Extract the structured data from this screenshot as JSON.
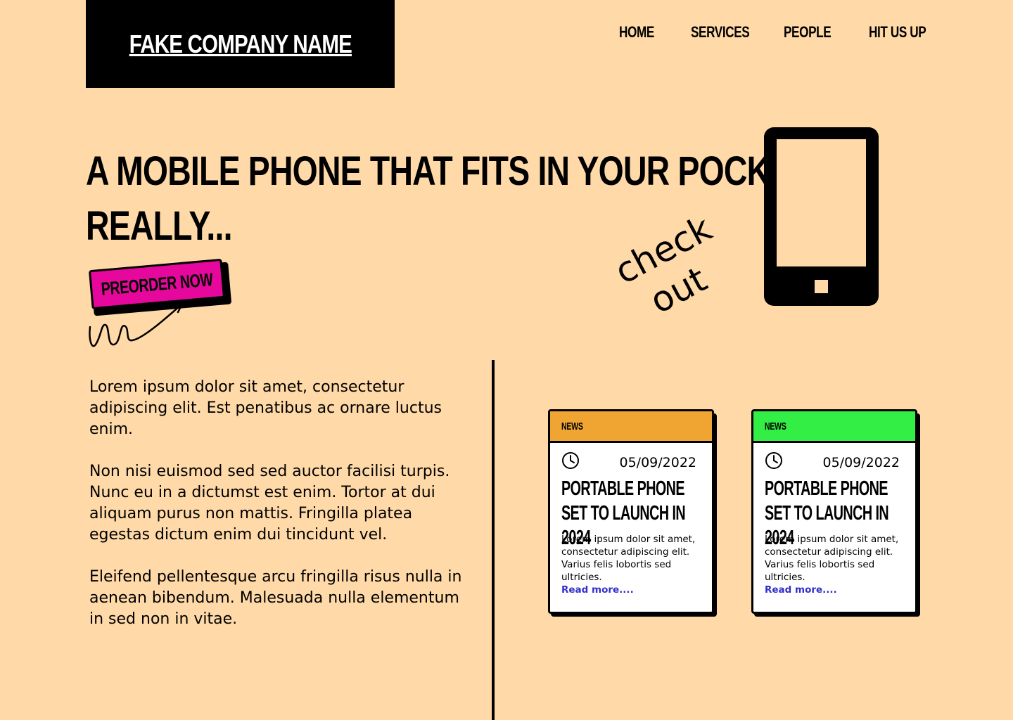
{
  "brand": {
    "name": "FAKE COMPANY NAME"
  },
  "nav": {
    "items": [
      {
        "label": "HOME"
      },
      {
        "label": "SERVICES"
      },
      {
        "label": "PEOPLE"
      },
      {
        "label": "HIT US UP"
      }
    ]
  },
  "hero": {
    "title_line1": "A MOBILE PHONE THAT FITS IN YOUR POCKET.",
    "title_line2": "REALLY...",
    "cta_label": "PREORDER NOW",
    "checkout_line1": "check",
    "checkout_line2": "out",
    "phone_icon": "mobile-phone-icon"
  },
  "body": {
    "paragraphs": [
      "Lorem ipsum dolor sit amet, consectetur adipiscing elit. Est penatibus ac ornare luctus enim.",
      "Non nisi euismod sed sed auctor facilisi turpis. Nunc eu in a dictumst est enim. Tortor at dui aliquam purus non mattis. Fringilla platea egestas dictum enim dui tincidunt vel.",
      "Eleifend pellentesque arcu fringilla risus nulla in aenean bibendum. Malesuada nulla elementum in sed non in vitae."
    ]
  },
  "news": {
    "cards": [
      {
        "tag": "NEWS",
        "date": "05/09/2022",
        "title": "PORTABLE PHONE SET TO LAUNCH IN 2024",
        "excerpt": "Lorem ipsum dolor sit amet, consectetur adipiscing elit. Varius felis lobortis sed ultricies.",
        "link": "Read more....",
        "header_color": "#F0A532"
      },
      {
        "tag": "NEWS",
        "date": "05/09/2022",
        "title": "PORTABLE PHONE SET TO LAUNCH IN 2024",
        "excerpt": "Lorem ipsum dolor sit amet, consectetur adipiscing elit. Varius felis lobortis sed ultricies.",
        "link": "Read more....",
        "header_color": "#33EE44"
      }
    ]
  },
  "colors": {
    "background": "#FFDAA8",
    "cta": "#E6089C",
    "link": "#3030CC"
  }
}
